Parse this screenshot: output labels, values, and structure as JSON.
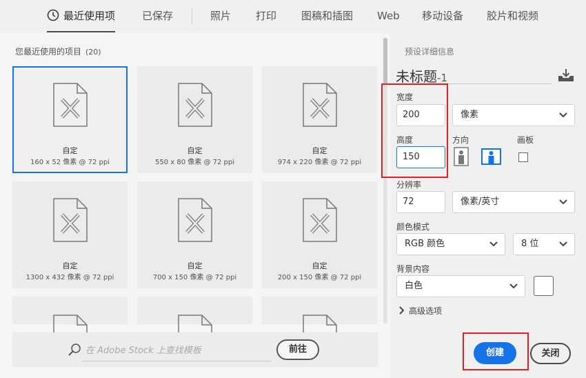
{
  "tabs": [
    {
      "label": "最近使用项",
      "active": true,
      "icon": "clock-icon"
    },
    {
      "label": "已保存"
    },
    {
      "label": "照片"
    },
    {
      "label": "打印"
    },
    {
      "label": "图稿和插图"
    },
    {
      "label": "Web"
    },
    {
      "label": "移动设备"
    },
    {
      "label": "胶片和视频"
    }
  ],
  "recent": {
    "title": "您最近使用的项目",
    "count": "(20)",
    "items": [
      {
        "name": "自定",
        "dims": "160 x 52 像素 @ 72 ppi",
        "selected": true
      },
      {
        "name": "自定",
        "dims": "550 x 80 像素 @ 72 ppi"
      },
      {
        "name": "自定",
        "dims": "974 x 220 像素 @ 72 ppi"
      },
      {
        "name": "自定",
        "dims": "1300 x 432 像素 @ 72 ppi"
      },
      {
        "name": "自定",
        "dims": "700 x 150 像素 @ 72 ppi"
      },
      {
        "name": "自定",
        "dims": "200 x 150 像素 @ 72 ppi"
      }
    ]
  },
  "stock": {
    "placeholder": "在 Adobe Stock 上查找模板",
    "go_label": "前往"
  },
  "preset": {
    "section_title": "预设详细信息",
    "doc_title": "未标题",
    "doc_suffix": "-1",
    "width_label": "宽度",
    "width_value": "200",
    "width_unit": "像素",
    "height_label": "高度",
    "height_value": "150",
    "orientation_label": "方向",
    "artboard_label": "画板",
    "resolution_label": "分辨率",
    "resolution_value": "72",
    "resolution_unit": "像素/英寸",
    "color_mode_label": "颜色模式",
    "color_mode_value": "RGB 颜色",
    "bit_depth_value": "8 位",
    "background_label": "背景内容",
    "background_value": "白色",
    "background_color": "#ffffff",
    "advanced_label": "高级选项"
  },
  "actions": {
    "create_label": "创建",
    "close_label": "关闭"
  },
  "colors": {
    "accent": "#1473e6",
    "highlight": "#e02020"
  }
}
